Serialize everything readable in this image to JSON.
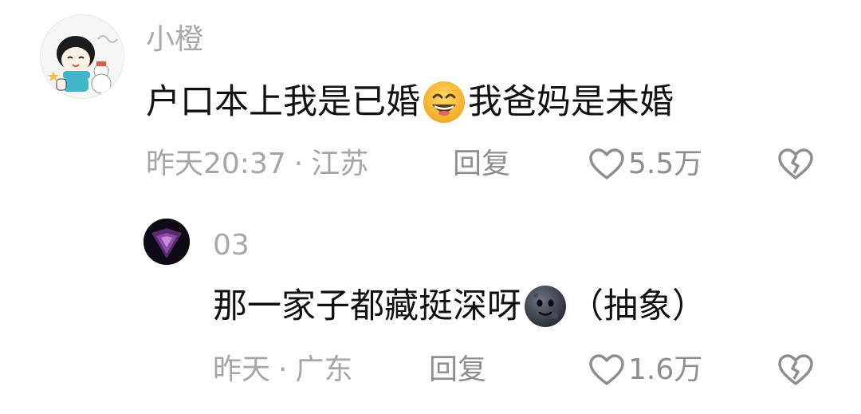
{
  "comments": [
    {
      "username": "小橙",
      "text_before": "户口本上我是已婚",
      "emoji": "grinning-face-emoji",
      "text_after": "我爸妈是未婚",
      "time": "昨天20:37",
      "separator": "·",
      "location": "江苏",
      "reply_label": "回复",
      "likes": "5.5万"
    },
    {
      "username": "03",
      "text_before": "那一家子都藏挺深呀",
      "emoji": "new-moon-face-emoji",
      "text_after": "（抽象）",
      "time": "昨天",
      "separator": "·",
      "location": "广东",
      "reply_label": "回复",
      "likes": "1.6万"
    }
  ],
  "icons": {
    "like": "heart-outline-icon",
    "dislike": "broken-heart-icon"
  },
  "colors": {
    "text_primary": "#111111",
    "text_secondary": "#a6a6a6",
    "icon_gray": "#8e8e8e",
    "emoji_yellow": "#f7b52c",
    "emoji_moon": "#3a3f4a"
  }
}
